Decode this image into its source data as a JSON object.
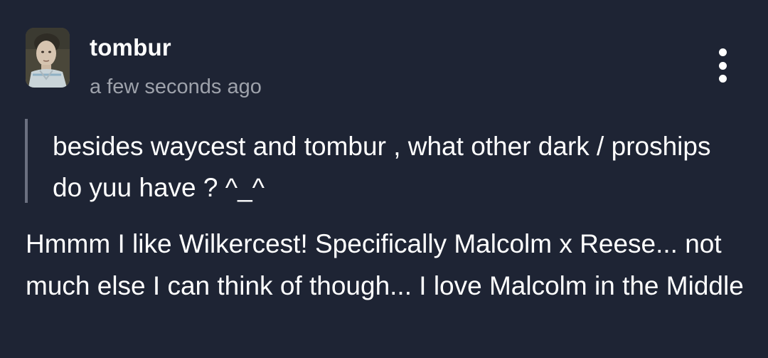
{
  "post": {
    "author": {
      "username": "tombur",
      "avatar_icon": "profile-photo"
    },
    "timestamp": "a few seconds ago",
    "menu_icon": "vertical-ellipsis-icon"
  },
  "ask": {
    "question": "besides waycest and tombur , what other dark / proships do yuu have ? ^_^"
  },
  "answer": {
    "text": "Hmmm I like Wilkercest! Specifically Malcolm x Reese... not much else I can think of though... I love Malcolm in the Middle"
  },
  "colors": {
    "background": "#1e2434",
    "text_primary": "#ffffff",
    "text_secondary": "#9ea2ab",
    "quote_bar": "#6b7080"
  }
}
